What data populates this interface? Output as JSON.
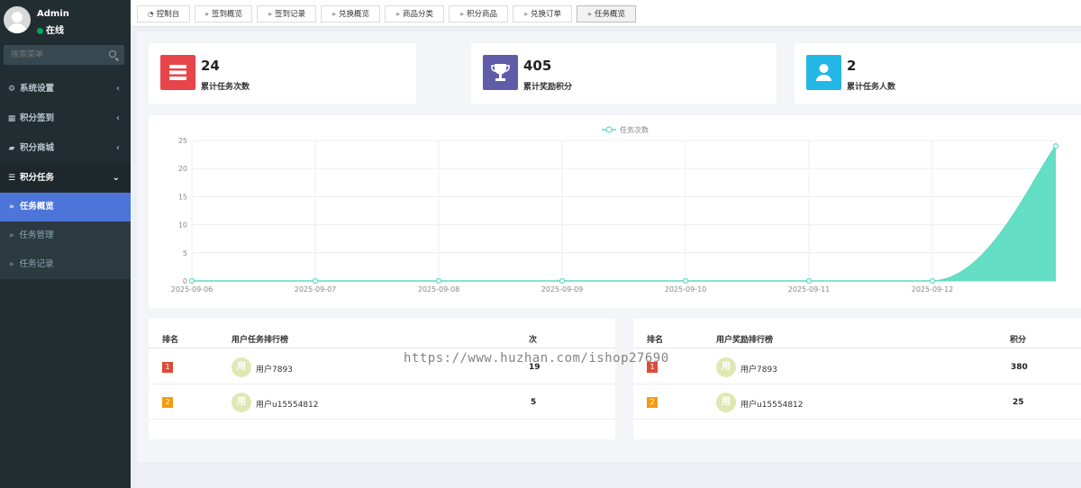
{
  "user": {
    "name": "Admin",
    "status": "在线"
  },
  "search": {
    "placeholder": "搜索菜单"
  },
  "menu": [
    {
      "label": "系统设置",
      "icon": "gears-icon"
    },
    {
      "label": "积分签到",
      "icon": "calendar-icon"
    },
    {
      "label": "积分商城",
      "icon": "shop-icon"
    },
    {
      "label": "积分任务",
      "icon": "tasks-icon",
      "open": true
    }
  ],
  "submenu": [
    {
      "label": "任务概览",
      "active": true
    },
    {
      "label": "任务管理"
    },
    {
      "label": "任务记录"
    }
  ],
  "tabs": [
    {
      "label": "控制台",
      "icon": "dashboard-icon"
    },
    {
      "label": "签到概览"
    },
    {
      "label": "签到记录"
    },
    {
      "label": "兑换概览"
    },
    {
      "label": "商品分类"
    },
    {
      "label": "积分商品"
    },
    {
      "label": "兑换订单"
    },
    {
      "label": "任务概览",
      "active": true
    }
  ],
  "stats": [
    {
      "value": "24",
      "label": "累计任务次数",
      "color": "#e8454a",
      "icon": "server-icon"
    },
    {
      "value": "405",
      "label": "累计奖励积分",
      "color": "#605ca8",
      "icon": "trophy-icon"
    },
    {
      "value": "2",
      "label": "累计任务人数",
      "color": "#23b7e5",
      "icon": "user-icon"
    }
  ],
  "chart_data": {
    "type": "area",
    "series": [
      {
        "name": "任务次数",
        "values": [
          0,
          0,
          0,
          0,
          0,
          0,
          0,
          24
        ],
        "color": "#5ddcc3"
      }
    ],
    "x": [
      "2025-09-06",
      "2025-09-07",
      "2025-09-08",
      "2025-09-09",
      "2025-09-10",
      "2025-09-11",
      "2025-09-12",
      ""
    ],
    "yticks": [
      0,
      5,
      10,
      15,
      20,
      25
    ],
    "ylim": [
      0,
      25
    ],
    "grid": true,
    "legend": "top-center"
  },
  "task_rank": {
    "col_rank": "排名",
    "col_user": "用户任务排行榜",
    "col_value": "次",
    "rows": [
      {
        "rank": "1",
        "avatar": "用",
        "user": "用户7893",
        "value": "19",
        "badge": "#dd4b39"
      },
      {
        "rank": "2",
        "avatar": "用",
        "user": "用户u15554812",
        "value": "5",
        "badge": "#f39c12"
      }
    ]
  },
  "reward_rank": {
    "col_rank": "排名",
    "col_user": "用户奖励排行榜",
    "col_value": "积分",
    "rows": [
      {
        "rank": "1",
        "avatar": "用",
        "user": "用户7893",
        "value": "380",
        "badge": "#dd4b39"
      },
      {
        "rank": "2",
        "avatar": "用",
        "user": "用户u15554812",
        "value": "25",
        "badge": "#f39c12"
      }
    ]
  },
  "watermark": "https://www.huzhan.com/ishop27690"
}
